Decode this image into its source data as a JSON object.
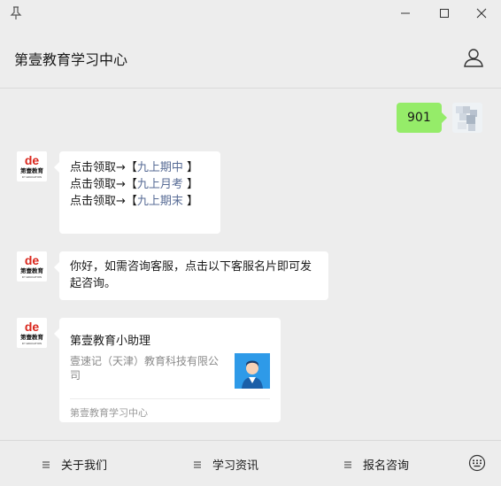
{
  "header": {
    "title": "第壹教育学习中心"
  },
  "chat": {
    "self_message": "901",
    "bot_message_1": {
      "lines": [
        {
          "prefix": "点击领取→【",
          "link": "九上期中",
          "suffix": " 】"
        },
        {
          "prefix": "点击领取→【",
          "link": "九上月考",
          "suffix": " 】"
        },
        {
          "prefix": "点击领取→【",
          "link": "九上期末",
          "suffix": " 】"
        }
      ]
    },
    "bot_message_2": "你好，如需咨询客服，点击以下客服名片即可发起咨询。",
    "card": {
      "title": "第壹教育小助理",
      "description": "壹速记（天津）教育科技有限公司",
      "footer": "第壹教育学习中心"
    }
  },
  "avatar_logo": {
    "brand": "de",
    "name": "第壹教育",
    "sub": "DY EDUCATION"
  },
  "menu": {
    "items": [
      {
        "label": "关于我们"
      },
      {
        "label": "学习资讯"
      },
      {
        "label": "报名咨询"
      }
    ]
  },
  "colors": {
    "self_bubble": "#95ec69",
    "link": "#576b95",
    "background": "#ededed",
    "brand_red": "#d9261c",
    "card_photo": "#2e9ae8"
  }
}
